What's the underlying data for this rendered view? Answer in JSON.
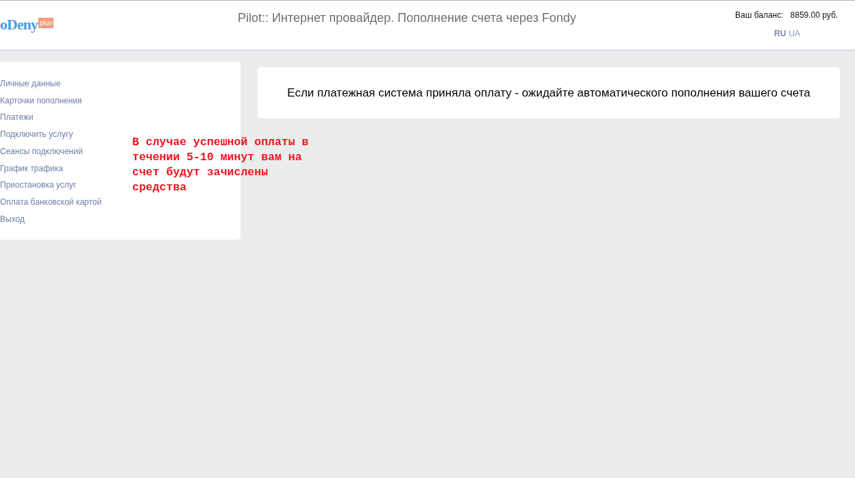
{
  "header": {
    "logo": {
      "text": "oDeny",
      "badge": "plus"
    },
    "title": "Pilot:: Интернет провайдер. Пополнение счета через Fondy",
    "balance_label": "Ваш баланс:",
    "balance_value": "8859.00 руб.",
    "languages": [
      {
        "label": "RU",
        "selected": true
      },
      {
        "label": "UA",
        "selected": false
      }
    ]
  },
  "sidebar": {
    "items": [
      {
        "label": "Личные данные"
      },
      {
        "label": "Карточки пополнения"
      },
      {
        "label": "Платежи"
      },
      {
        "label": "Подключить услугу"
      },
      {
        "label": "Сеансы подключений"
      },
      {
        "label": "График трафика"
      },
      {
        "label": "Приостановка услуг"
      },
      {
        "label": "Оплата банковской картой"
      },
      {
        "label": "Выход"
      }
    ]
  },
  "notice": "В случае успешной оплаты в течении 5-10 минут вам на счет будут зачислены средства",
  "message": "Если платежная система приняла оплату - ожидайте автоматического пополнения вашего счета"
}
